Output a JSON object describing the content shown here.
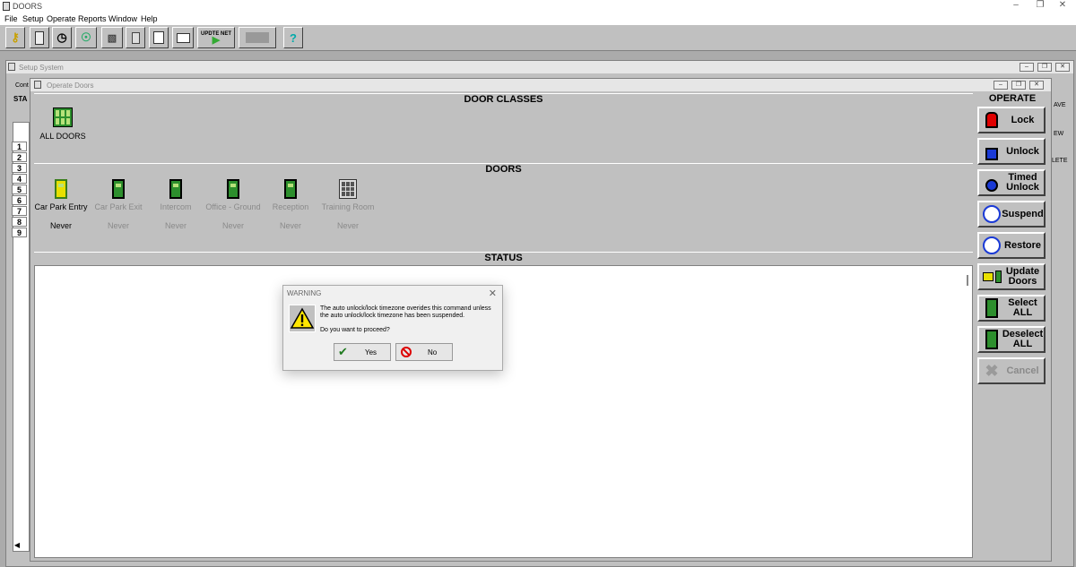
{
  "app": {
    "title": "DOORS"
  },
  "menu": [
    "File",
    "Setup",
    "Operate",
    "Reports",
    "Window",
    "Help"
  ],
  "toolbar": {
    "update_net_label": "UPDTE NET",
    "help_label": "?"
  },
  "setup_window": {
    "title": "Setup System",
    "tab_partial": "Cont",
    "sta_partial": "STA",
    "rows": [
      "1",
      "2",
      "3",
      "4",
      "5",
      "6",
      "7",
      "8",
      "9"
    ],
    "right_partials": [
      "AVE",
      "EW",
      "LETE"
    ]
  },
  "operate_window": {
    "title": "Operate Doors"
  },
  "sections": {
    "door_classes": "DOOR CLASSES",
    "doors": "DOORS",
    "status": "STATUS",
    "operate": "OPERATE"
  },
  "door_classes": [
    {
      "name": "ALL DOORS"
    }
  ],
  "doors": [
    {
      "name": "Car Park Entry",
      "status": "Never",
      "selected": true
    },
    {
      "name": "Car Park Exit",
      "status": "Never",
      "selected": false
    },
    {
      "name": "Intercom",
      "status": "Never",
      "selected": false
    },
    {
      "name": "Office - Ground",
      "status": "Never",
      "selected": false
    },
    {
      "name": "Reception",
      "status": "Never",
      "selected": false
    },
    {
      "name": "Training Room",
      "status": "Never",
      "selected": false
    }
  ],
  "operate_buttons": [
    {
      "label": "Lock",
      "icon": "padlock-locked-icon"
    },
    {
      "label": "Unlock",
      "icon": "padlock-unlocked-icon"
    },
    {
      "label": "Timed Unlock",
      "icon": "timed-unlock-icon"
    },
    {
      "label": "Suspend",
      "icon": "suspend-icon"
    },
    {
      "label": "Restore",
      "icon": "restore-icon"
    },
    {
      "label": "Update Doors",
      "icon": "update-doors-icon"
    },
    {
      "label": "Select ALL",
      "icon": "select-all-icon"
    },
    {
      "label": "Deselect ALL",
      "icon": "deselect-all-icon"
    },
    {
      "label": "Cancel",
      "icon": "cancel-x-icon",
      "disabled": true
    }
  ],
  "dialog": {
    "title": "WARNING",
    "message": "The auto unlock/lock timezone overides this command unless the auto unlock/lock timezone has been suspended.",
    "question": "Do you want to proceed?",
    "yes_label": "Yes",
    "no_label": "No"
  },
  "colors": {
    "green_door": "#2d8f2d",
    "selected_door": "#e8e000",
    "lock_red": "#e00000",
    "unlock_blue": "#1a3ad6"
  }
}
